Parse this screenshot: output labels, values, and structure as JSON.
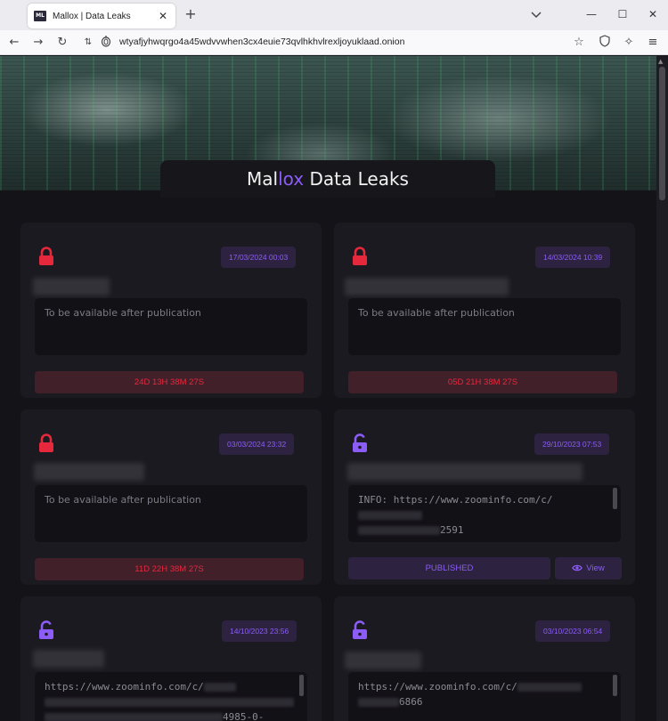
{
  "browser": {
    "tab_title": "Mallox | Data Leaks",
    "favicon_text": "ML",
    "url": "wtyafjyhwqrgo4a45wdvvwhen3cx4euie73qvlhkhvlrexljoyuklaad.onion"
  },
  "site": {
    "title_part1": "Mal",
    "title_accent": "lox",
    "title_part2": " Data Leaks",
    "accent_color": "#8b5cf6",
    "locked_color": "#e6283d"
  },
  "cards": [
    {
      "lock": "locked",
      "date": "17/03/2024 00:03",
      "description": "To be available after publication",
      "countdown": "24D 13H 38M 27S"
    },
    {
      "lock": "locked",
      "date": "14/03/2024 10:39",
      "description": "To be available after publication",
      "countdown": "05D 21H 38M 27S"
    },
    {
      "lock": "locked",
      "date": "03/03/2024 23:32",
      "description": "To be available after publication",
      "countdown": "11D 22H 38M 27S"
    },
    {
      "lock": "unlocked",
      "date": "29/10/2023 07:53",
      "info_prefix": "INFO: https://www.zoominfo.com/c/",
      "info_suffix": "2591",
      "status": "PUBLISHED",
      "view_label": "View"
    },
    {
      "lock": "unlocked",
      "date": "14/10/2023 23:56",
      "info_prefix": "https://www.zoominfo.com/c/",
      "info_suffix": "4985-0-"
    },
    {
      "lock": "unlocked",
      "date": "03/10/2023 06:54",
      "info_prefix": "https://www.zoominfo.com/c/",
      "info_suffix": "6866"
    }
  ]
}
